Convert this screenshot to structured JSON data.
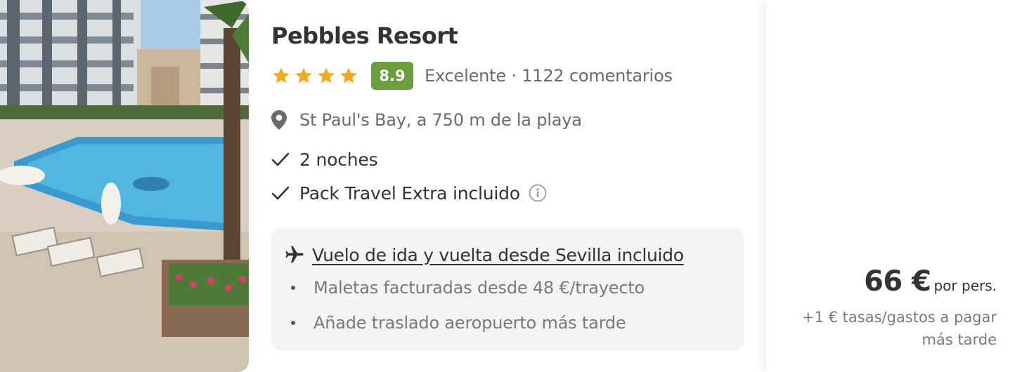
{
  "hotel": {
    "name": "Pebbles Resort",
    "star_count": 4,
    "score": "8.9",
    "rating_summary": "Excelente · 1122 comentarios",
    "location": "St Paul's Bay, a 750 m de la playa",
    "nights": "2 noches",
    "pack": "Pack Travel Extra incluido"
  },
  "flight": {
    "title": "Vuelo de ida y vuelta desde Sevilla incluido",
    "bullets": [
      "Maletas facturadas desde 48 €/trayecto",
      "Añade traslado aeropuerto más tarde"
    ]
  },
  "price": {
    "amount": "66 €",
    "per": "por pers.",
    "taxes_line1": "+1 € tasas/gastos a pagar",
    "taxes_line2": "más tarde"
  },
  "colors": {
    "star": "#f5a623",
    "score_badge": "#6a9d3c",
    "flight_box_bg": "#f4f4f4"
  },
  "icons": {
    "location": "map-pin-icon",
    "check": "check-icon",
    "info": "info-icon",
    "plane": "plane-icon"
  }
}
